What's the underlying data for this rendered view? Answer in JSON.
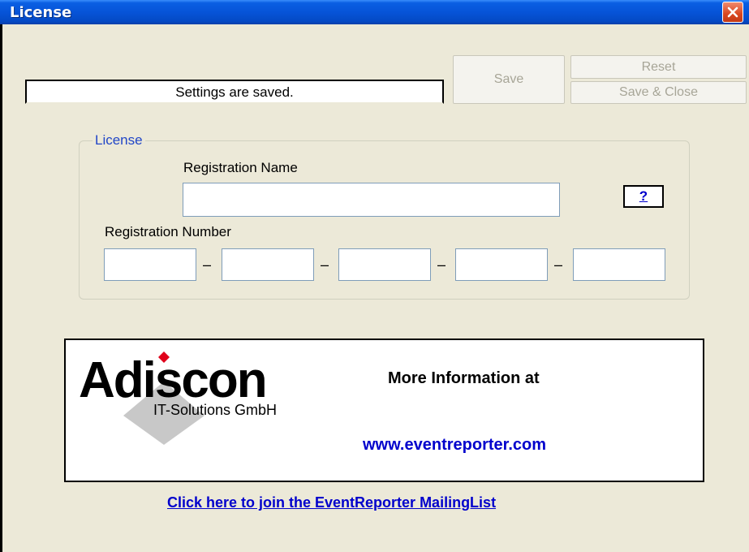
{
  "window": {
    "title": "License"
  },
  "toolbar": {
    "status_text": "Settings are saved.",
    "save_label": "Save",
    "reset_label": "Reset",
    "save_close_label": "Save & Close"
  },
  "license_group": {
    "legend": "License",
    "reg_name_label": "Registration Name",
    "reg_name_value": "",
    "help_label": "?",
    "reg_number_label": "Registration Number",
    "reg_number_parts": [
      "",
      "",
      "",
      "",
      ""
    ],
    "separator": "–"
  },
  "banner": {
    "logo_name": "Adiscon",
    "logo_subtitle": "IT-Solutions GmbH",
    "info_title": "More Information at",
    "info_url": "www.eventreporter.com"
  },
  "mailing_list_link": "Click here to join the EventReporter MailingList",
  "icons": {
    "close": "close-x-icon",
    "logo_mark": "diamond-logo-icon"
  }
}
